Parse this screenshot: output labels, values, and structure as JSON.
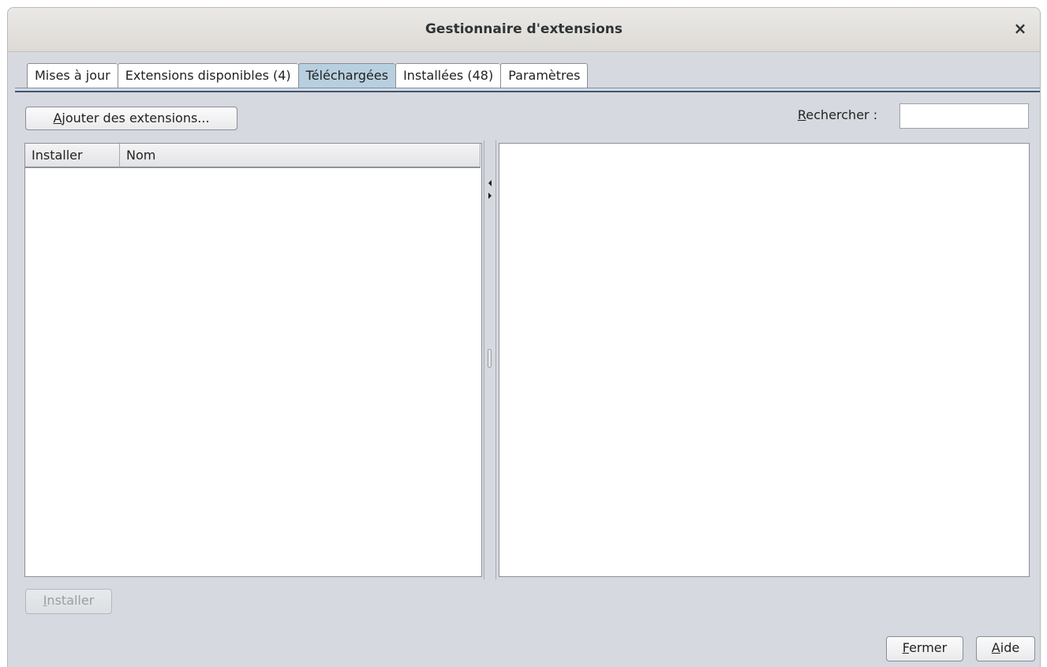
{
  "window": {
    "title": "Gestionnaire d'extensions",
    "close_glyph": "×",
    "close_icon": "close-icon"
  },
  "tabs": [
    {
      "label": "Mises à jour",
      "active": false
    },
    {
      "label": "Extensions disponibles (4)",
      "active": false
    },
    {
      "label": "Téléchargées",
      "active": true
    },
    {
      "label": "Installées (48)",
      "active": false
    },
    {
      "label": "Paramètres",
      "active": false
    }
  ],
  "toolbar": {
    "add_button": {
      "mnemonic": "A",
      "rest": "jouter des extensions..."
    },
    "search_label": {
      "mnemonic": "R",
      "rest": "echercher :"
    },
    "search_value": ""
  },
  "table": {
    "columns": [
      "Installer",
      "Nom"
    ],
    "rows": []
  },
  "splitter": {
    "left_arrow": "arrow-left-icon",
    "right_arrow": "arrow-right-icon"
  },
  "install_button": {
    "mnemonic": "I",
    "rest": "nstaller",
    "enabled": false
  },
  "footer": {
    "close_button": {
      "mnemonic": "F",
      "rest": "ermer"
    },
    "help_button": {
      "mnemonic": "A",
      "rest": "ide"
    }
  },
  "colors": {
    "active_tab": "#b8cfe0",
    "window_bg": "#d6d9df",
    "tab_separator": "#3d5675"
  }
}
